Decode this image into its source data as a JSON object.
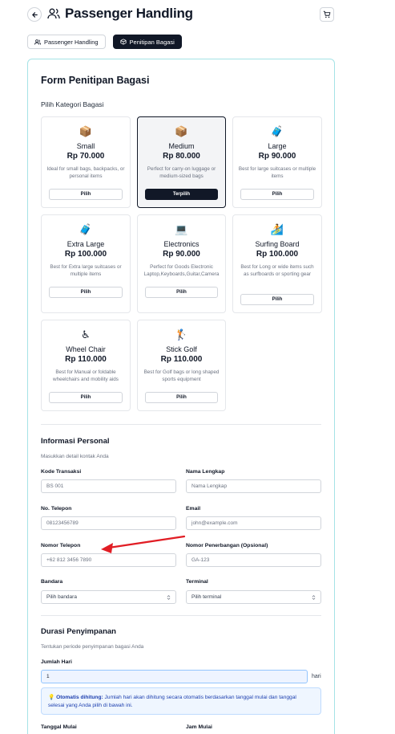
{
  "header": {
    "title": "Passenger Handling"
  },
  "tabs": [
    {
      "label": "Passenger Handling",
      "active": false
    },
    {
      "label": "Penitipan Bagasi",
      "active": true
    }
  ],
  "form": {
    "title": "Form Penitipan Bagasi",
    "category_heading": "Pilih Kategori Bagasi",
    "pick_label": "Pilih",
    "picked_label": "Terpilih",
    "categories": [
      {
        "name": "Small",
        "price": "Rp 70.000",
        "desc": "Ideal for small bags, backpacks, or personal items",
        "icon": "package-icon",
        "emoji": "📦"
      },
      {
        "name": "Medium",
        "price": "Rp 80.000",
        "desc": "Perfect for carry-on luggage or medium-sized bags",
        "icon": "package-icon",
        "emoji": "📦",
        "selected": true
      },
      {
        "name": "Large",
        "price": "Rp 90.000",
        "desc": "Best for large suitcases or multiple items",
        "icon": "suitcase-icon",
        "emoji": "🧳"
      },
      {
        "name": "Extra Large",
        "price": "Rp 100.000",
        "desc": "Best for Extra large suitcases or multiple items",
        "icon": "suitcase-icon",
        "emoji": "🧳"
      },
      {
        "name": "Electronics",
        "price": "Rp 90.000",
        "desc": "Perfect for Goods Electronic Laptop,Keyboards,Guitar,Camera",
        "icon": "laptop-icon",
        "emoji": "💻"
      },
      {
        "name": "Surfing Board",
        "price": "Rp 100.000",
        "desc": "Best for Long or wide items such as surfboards or sporting gear",
        "icon": "surfer-icon",
        "emoji": "🏄"
      },
      {
        "name": "Wheel Chair",
        "price": "Rp 110.000",
        "desc": "Best for Manual or foldable wheelchairs and mobility aids",
        "icon": "wheelchair-icon",
        "emoji": "♿"
      },
      {
        "name": "Stick Golf",
        "price": "Rp 110.000",
        "desc": "Best for Golf bags or long shaped sports equipment",
        "icon": "golfer-icon",
        "emoji": "🏌"
      }
    ]
  },
  "personal": {
    "heading": "Informasi Personal",
    "subheading": "Masukkan detail kontak Anda",
    "kode_label": "Kode Transaksi",
    "kode_value": "BS 001",
    "nama_label": "Nama Lengkap",
    "nama_placeholder": "Nama Lengkap",
    "telepon_label": "No. Telepon",
    "telepon_value": "08123456789",
    "email_label": "Email",
    "email_placeholder": "john@example.com",
    "nomor_label": "Nomor Telepon",
    "nomor_placeholder": "+62 812 3456 7890",
    "penerbangan_label": "Nomor Penerbangan (Opsional)",
    "penerbangan_placeholder": "GA-123",
    "bandara_label": "Bandara",
    "bandara_value": "Pilih bandara",
    "terminal_label": "Terminal",
    "terminal_value": "Pilih terminal"
  },
  "duration": {
    "heading": "Durasi Penyimpanan",
    "subheading": "Tentukan periode penyimpanan bagasi Anda",
    "days_label": "Jumlah Hari",
    "days_value": "1",
    "days_unit": "hari",
    "info_bold": "Otomatis dihitung:",
    "info_text": " Jumlah hari akan dihitung secara otomatis berdasarkan tanggal mulai dan tanggal selesai yang Anda pilih di bawah ini.",
    "start_date_label": "Tanggal Mulai",
    "start_time_label": "Jam Mulai"
  },
  "colors": {
    "accent_dark": "#111827",
    "card_border": "#a5e3e6",
    "annotation_arrow": "#e11d24"
  }
}
